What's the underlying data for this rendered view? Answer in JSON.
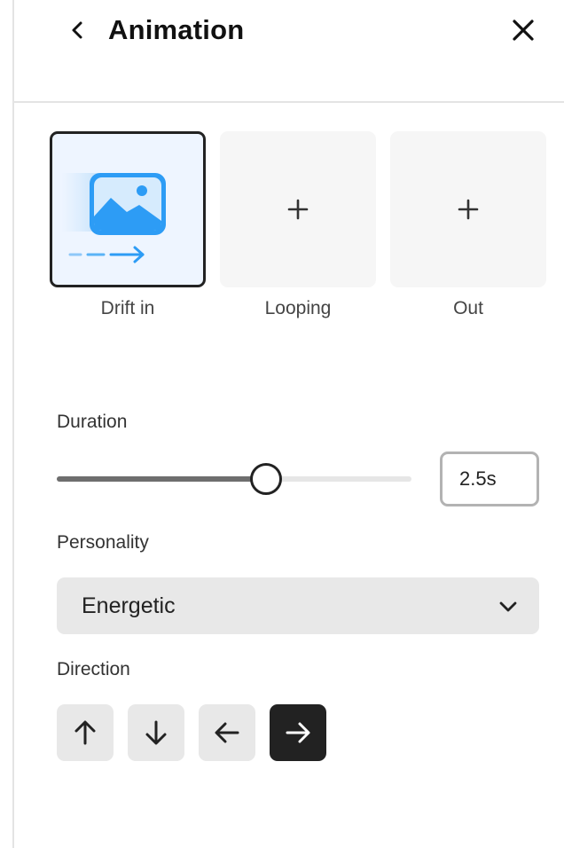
{
  "panel": {
    "title": "Animation",
    "back_icon": "chevron-left-icon",
    "close_icon": "close-icon"
  },
  "animation_slots": [
    {
      "label": "Drift in",
      "selected": true,
      "icon": "image-drift-in-icon"
    },
    {
      "label": "Looping",
      "selected": false,
      "icon": "plus-icon"
    },
    {
      "label": "Out",
      "selected": false,
      "icon": "plus-icon"
    }
  ],
  "duration": {
    "label": "Duration",
    "value": "2.5s",
    "slider_fraction": 0.59
  },
  "personality": {
    "label": "Personality",
    "selected": "Energetic"
  },
  "direction": {
    "label": "Direction",
    "options": [
      {
        "icon": "arrow-up-icon",
        "active": false
      },
      {
        "icon": "arrow-down-icon",
        "active": false
      },
      {
        "icon": "arrow-left-icon",
        "active": false
      },
      {
        "icon": "arrow-right-icon",
        "active": true
      }
    ]
  },
  "colors": {
    "accent_blue": "#2d9cf5",
    "selected_dark": "#222222",
    "button_gray": "#e8e8e8"
  }
}
